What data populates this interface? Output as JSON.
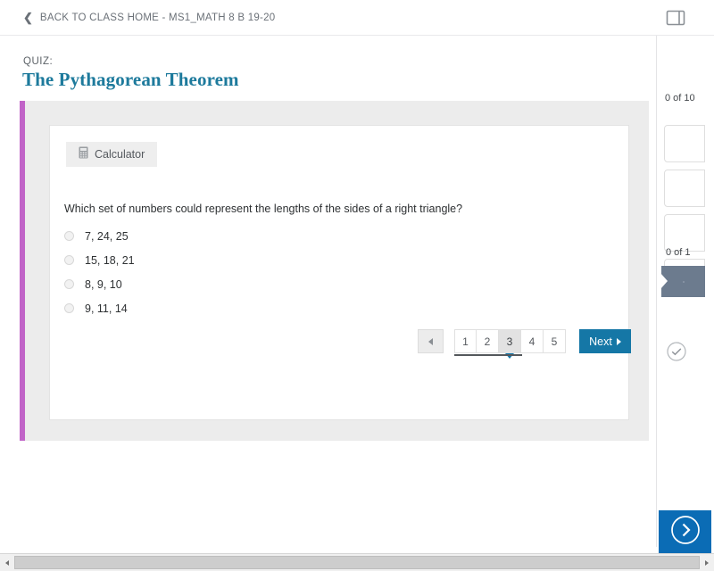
{
  "header": {
    "back_chevron": "chevron-left-icon",
    "back_label": "BACK TO CLASS HOME - MS1_MATH 8 B 19-20",
    "panel_toggle_icon": "sidebar-panel-icon"
  },
  "quiz": {
    "kicker": "QUIZ:",
    "title": "The Pythagorean Theorem",
    "accent_color": "#c164c8",
    "title_color": "#1d7a9c"
  },
  "question_card": {
    "calculator": {
      "label": "Calculator",
      "icon": "calculator-icon"
    },
    "question_text": "Which set of numbers could represent the lengths of the sides of a right triangle?",
    "options": [
      {
        "label": "7, 24, 25",
        "selected": false
      },
      {
        "label": "15, 18, 21",
        "selected": false
      },
      {
        "label": "8, 9, 10",
        "selected": false
      },
      {
        "label": "9, 11, 14",
        "selected": false
      }
    ]
  },
  "pagination": {
    "prev_icon": "triangle-left-icon",
    "pages": [
      {
        "label": "1",
        "active": false
      },
      {
        "label": "2",
        "active": false
      },
      {
        "label": "3",
        "active": true
      },
      {
        "label": "4",
        "active": false
      },
      {
        "label": "5",
        "active": false
      }
    ],
    "next_label": "Next",
    "next_icon": "triangle-right-icon",
    "next_color": "#1577a6",
    "active_page": "3"
  },
  "right_rail": {
    "total_score": "0 of 10",
    "item_score": "0 of 1",
    "marker_color": "#6c7b8e",
    "check_icon": "check-circle-icon"
  },
  "next_panel": {
    "icon": "chevron-right-circle-icon",
    "color": "#0b6cb5"
  },
  "scrollbar": {
    "left_arrow_icon": "scroll-left-arrow-icon",
    "right_arrow_icon": "scroll-right-arrow-icon"
  }
}
